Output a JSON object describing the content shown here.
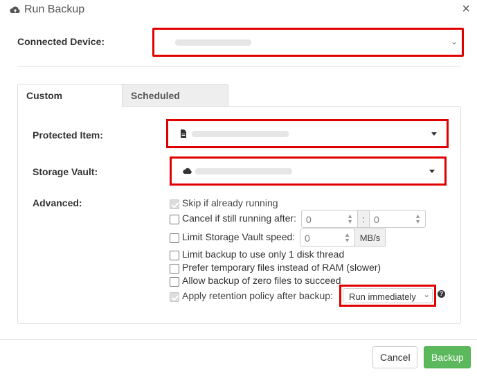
{
  "dialog": {
    "title": "Run Backup",
    "close_glyph": "×"
  },
  "device": {
    "label": "Connected Device:",
    "chevron": "⌄"
  },
  "tabs": [
    {
      "label": "Custom",
      "active": true
    },
    {
      "label": "Scheduled",
      "active": false
    }
  ],
  "form": {
    "protected_item_label": "Protected Item:",
    "storage_vault_label": "Storage Vault:",
    "advanced_label": "Advanced:"
  },
  "options": {
    "skip_running": "Skip if already running",
    "cancel_running": "Cancel if still running after:",
    "cancel_hours": "0",
    "cancel_sep": ":",
    "cancel_minutes": "0",
    "limit_speed": "Limit Storage Vault speed:",
    "limit_speed_value": "0",
    "limit_speed_unit": "MB/s",
    "one_thread": "Limit backup to use only 1 disk thread",
    "temp_files": "Prefer temporary files instead of RAM (slower)",
    "zero_files": "Allow backup of zero files to succeed",
    "retention": "Apply retention policy after backup:",
    "retention_select": "Run immediately",
    "help_glyph": "?"
  },
  "footer": {
    "cancel_label": "Cancel",
    "backup_label": "Backup"
  },
  "colors": {
    "highlight": "#e00000",
    "primary": "#5cb85c"
  }
}
